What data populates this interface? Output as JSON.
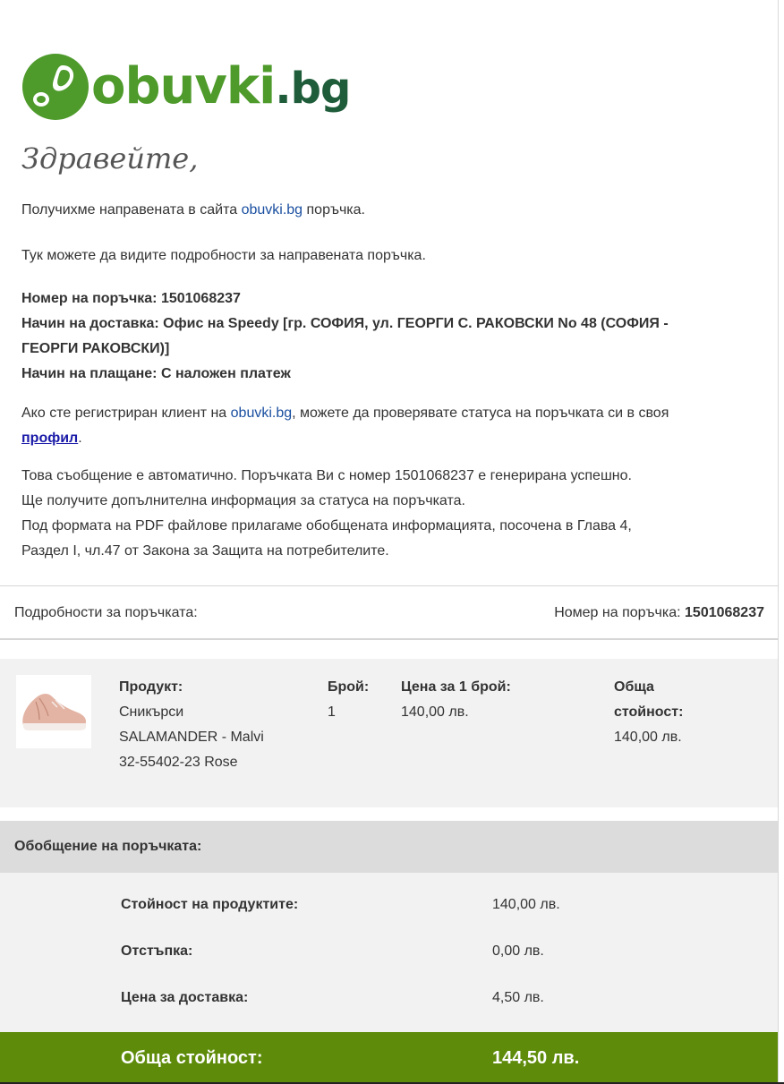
{
  "logo": {
    "word_main": "obuvki",
    "word_tld": ".bg"
  },
  "greeting": "Здравейте,",
  "intro": {
    "line1_before": "Получихме направената в сайта ",
    "line1_link": "obuvki.bg",
    "line1_after": " поръчка.",
    "line2": "Тук можете да видите подробности за направената поръчка."
  },
  "order_info": {
    "number_label": "Номер на поръчка:",
    "number_value": "1501068237",
    "delivery_label": "Начин на доставка:",
    "delivery_value_line1": "Офис на Speedy [гр. СОФИЯ, ул. ГЕОРГИ С. РАКОВСКИ No 48 (СОФИЯ -",
    "delivery_value_line2": "ГЕОРГИ РАКОВСКИ)]",
    "payment_label": "Начин на плащане:",
    "payment_value": "С наложен платеж"
  },
  "registered": {
    "before": "Ако сте регистриран клиент на ",
    "link": "obuvki.bg",
    "after": ", можете да проверявате статуса на поръчката си в своя",
    "profile_link": "профил",
    "end": "."
  },
  "auto_message": {
    "line1": "Това съобщение е автоматично. Поръчката Ви с номер 1501068237 е генерирана успешно.",
    "line2": "Ще получите допълнителна информация за статуса на поръчката.",
    "line3": "Под формата на PDF файлове прилагаме обобщената информацията, посочена в Глава 4,",
    "line4": "Раздел I, чл.47 от Закона за Защита на потребителите."
  },
  "details": {
    "title": "Подробности за поръчката:",
    "order_label": "Номер на поръчка: ",
    "order_value": "1501068237"
  },
  "product": {
    "product_header": "Продукт:",
    "name_lines": [
      "Сникърси",
      "SALAMANDER - Malvi",
      "32-55402-23 Rose"
    ],
    "qty_header": "Брой:",
    "qty": "1",
    "unit_price_header": "Цена за 1 брой:",
    "unit_price": "140,00 лв.",
    "total_header_line1": "Обща",
    "total_header_line2": "стойност:",
    "total": "140,00 лв."
  },
  "summary": {
    "title": "Обобщение на поръчката:",
    "rows": [
      {
        "label": "Стойност на продуктите:",
        "value": "140,00 лв."
      },
      {
        "label": "Отстъпка:",
        "value": "0,00 лв."
      },
      {
        "label": "Цена за доставка:",
        "value": "4,50 лв."
      }
    ],
    "total_label": "Обща стойност:",
    "total_value": "144,50 лв."
  },
  "colors": {
    "brand_green": "#4e9a2b",
    "brand_dark_green": "#1f5c3a",
    "total_bar": "#5e8c0a",
    "link": "#1a4fa0"
  }
}
